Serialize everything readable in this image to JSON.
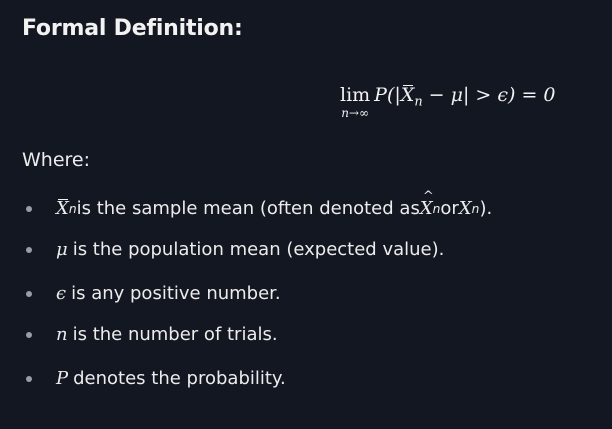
{
  "heading": "Formal Definition:",
  "equation": {
    "lim": "lim",
    "lim_sub": "n→∞",
    "lhs_prefix": "P(|",
    "var": "X",
    "var_sub": "n",
    "middle": " − μ| > ϵ) = 0"
  },
  "where_label": "Where:",
  "definitions": [
    {
      "symbol": "X",
      "symbol_sub": "n",
      "text_a": " is the sample mean (often denoted as ",
      "alt1": "X",
      "alt1_sub": "n",
      "text_or": " or ",
      "alt2": "X",
      "alt2_sub": "n",
      "text_end": ")."
    },
    {
      "symbol": "μ",
      "text": " is the population mean (expected value)."
    },
    {
      "symbol": "ϵ",
      "text": " is any positive number."
    },
    {
      "symbol": "n",
      "text": " is the number of trials."
    },
    {
      "symbol": "P",
      "text": " denotes the probability."
    }
  ]
}
